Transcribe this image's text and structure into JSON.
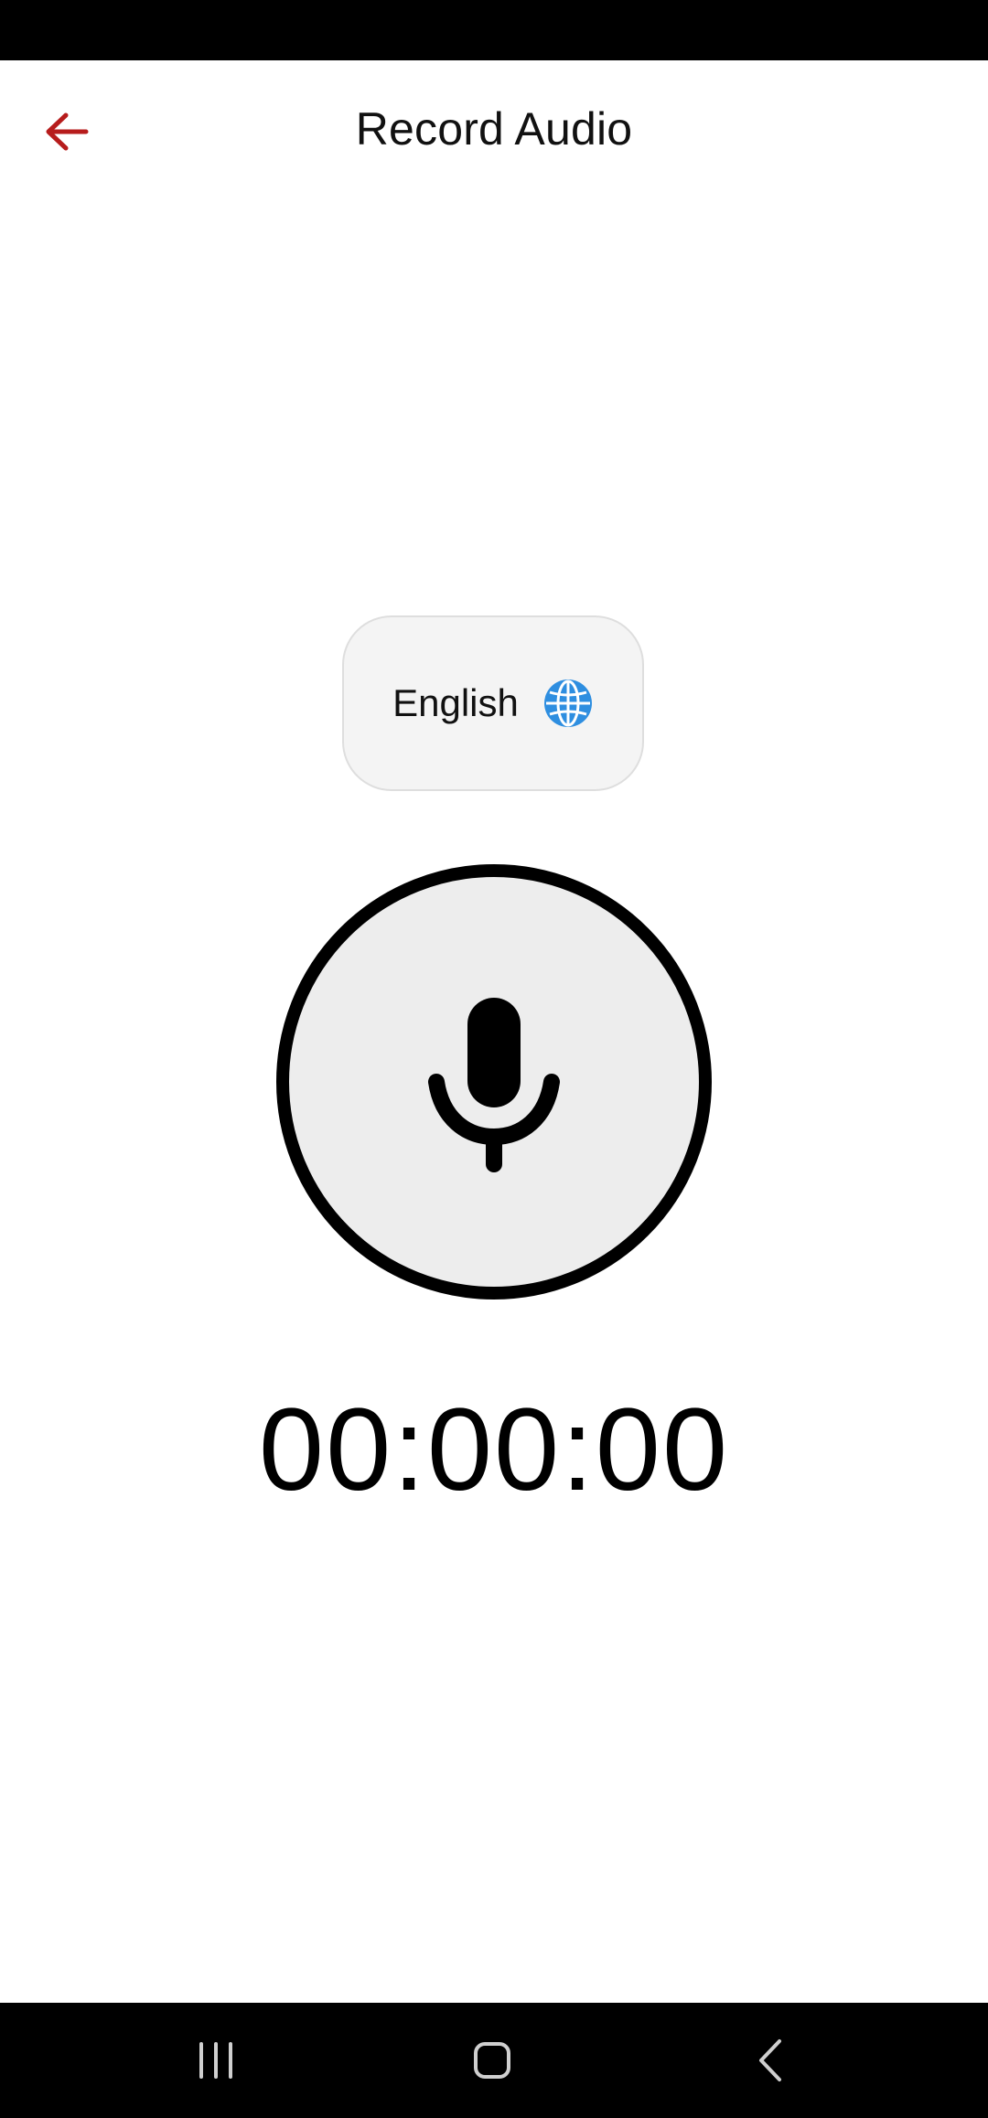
{
  "header": {
    "title": "Record Audio",
    "back_icon": "arrow-left-icon",
    "accent_color": "#b71c1c"
  },
  "language_selector": {
    "label": "English",
    "icon": "globe-icon",
    "icon_color": "#2e8ee0"
  },
  "recorder": {
    "icon": "microphone-icon",
    "timer": "00:00:00"
  },
  "system_nav": {
    "recents_icon": "recents-icon",
    "home_icon": "home-icon",
    "back_icon": "nav-back-icon"
  }
}
